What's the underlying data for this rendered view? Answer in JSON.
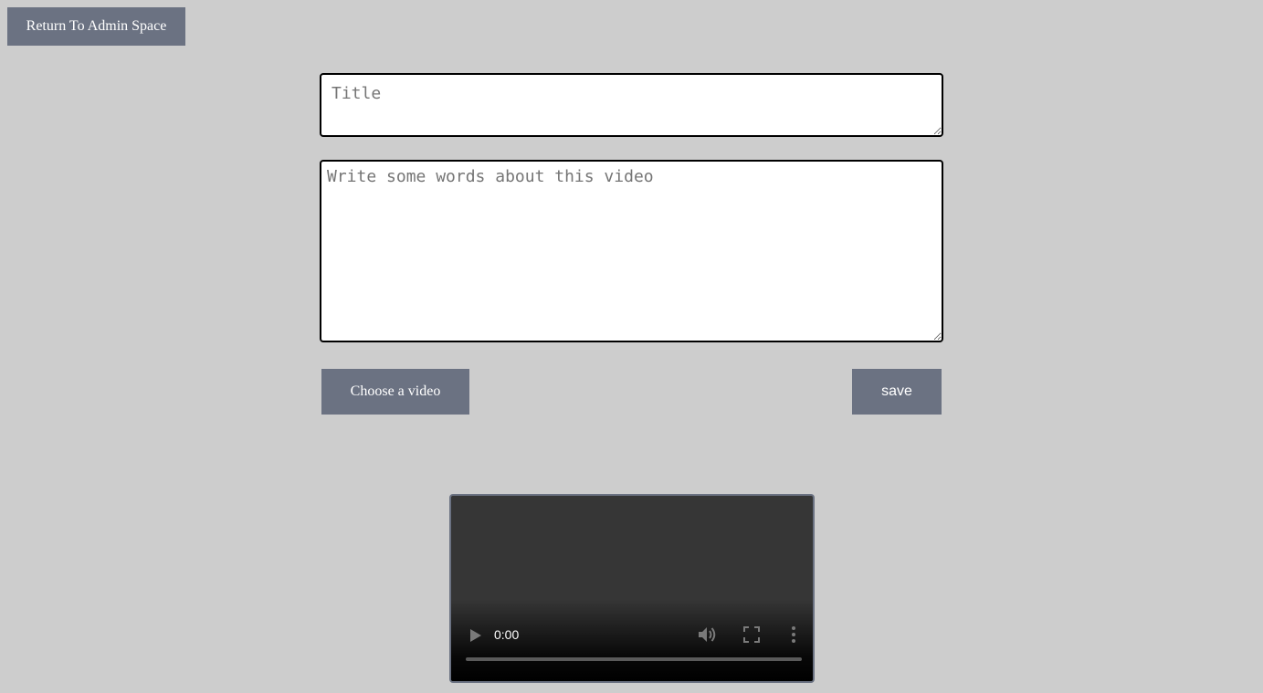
{
  "header": {
    "return_label": "Return To Admin Space"
  },
  "form": {
    "title_placeholder": "Title",
    "title_value": "",
    "description_placeholder": "Write some words about this video",
    "description_value": "",
    "choose_video_label": "Choose a video",
    "save_label": "save"
  },
  "video_player": {
    "current_time": "0:00",
    "progress": 0,
    "icons": {
      "play": "play-icon",
      "volume": "volume-icon",
      "fullscreen": "fullscreen-icon",
      "more": "more-vertical-icon"
    }
  },
  "colors": {
    "background": "#cdcdcd",
    "button": "#6b7282",
    "button_text": "#ffffff",
    "video_bg": "#363636"
  }
}
